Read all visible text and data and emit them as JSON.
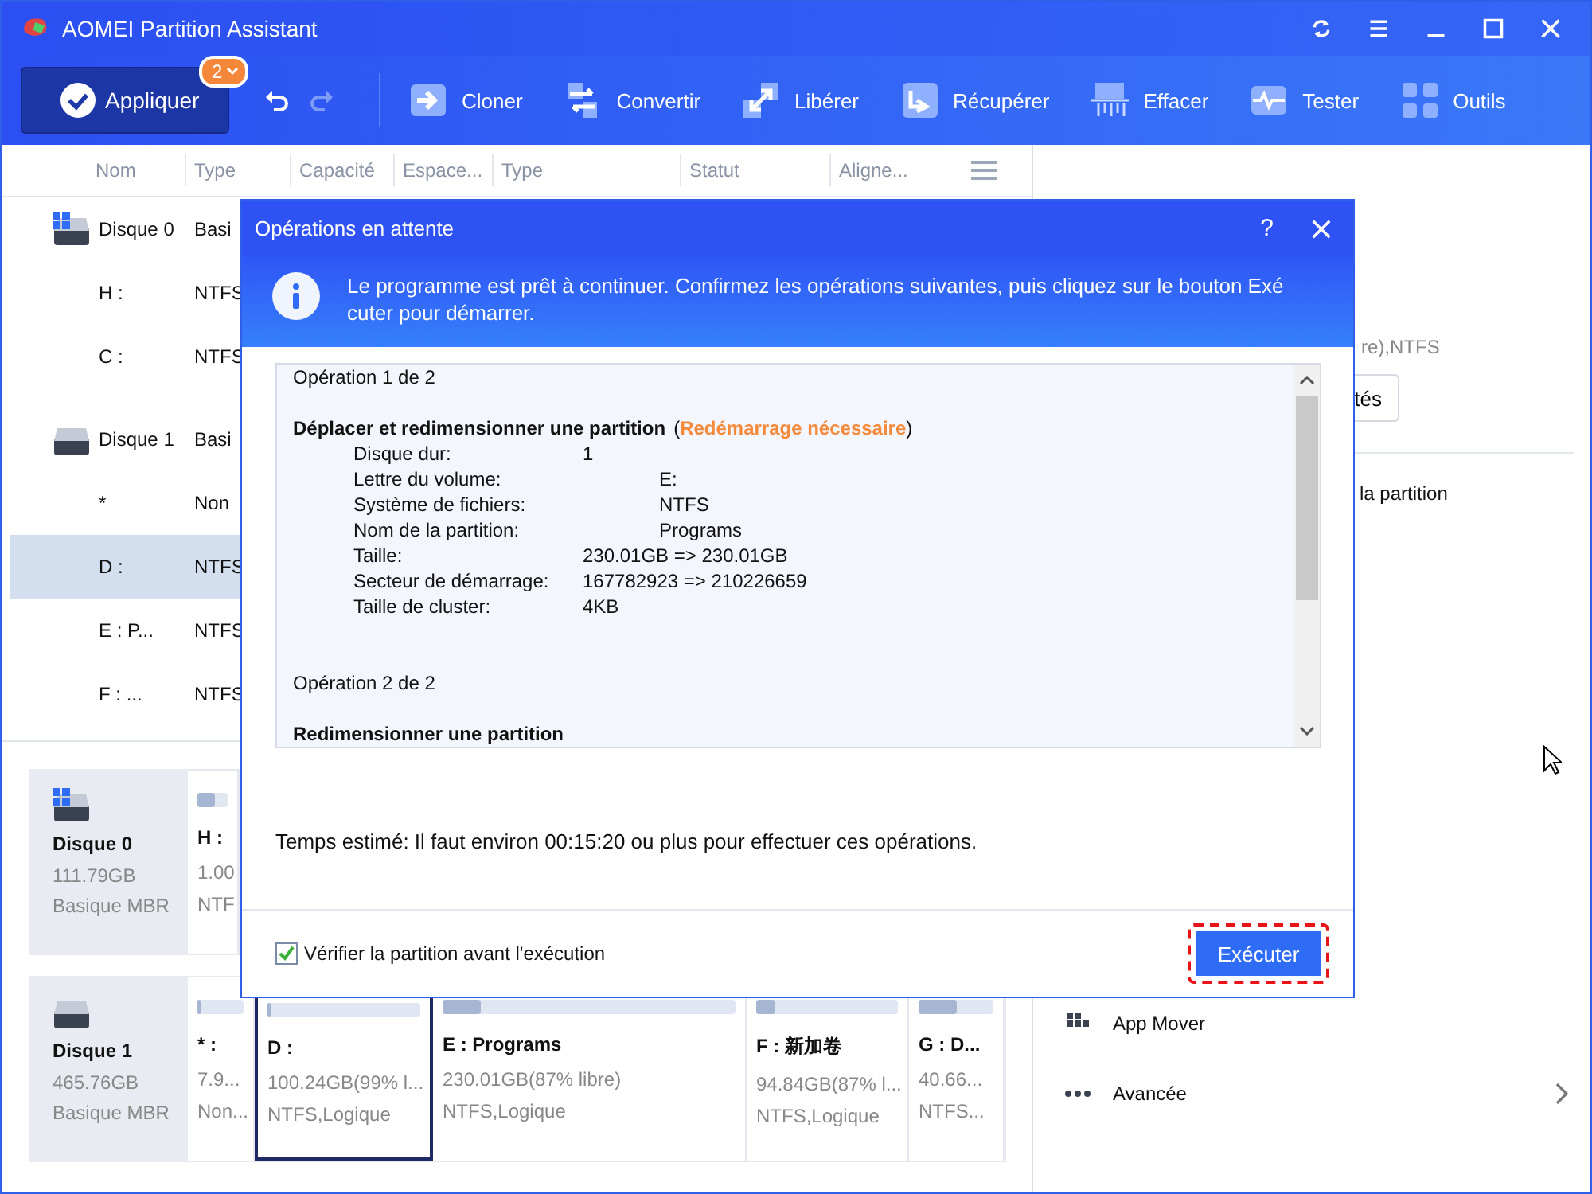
{
  "window": {
    "title": "AOMEI Partition Assistant"
  },
  "toolbar": {
    "apply": {
      "label": "Appliquer",
      "badge": "2"
    },
    "history": [
      {
        "kind": "undo",
        "disabled": false
      },
      {
        "kind": "redo",
        "disabled": true
      }
    ],
    "tools": [
      {
        "kind": "clone",
        "label": "Cloner"
      },
      {
        "kind": "convert",
        "label": "Convertir"
      },
      {
        "kind": "free",
        "label": "Libérer"
      },
      {
        "kind": "recover",
        "label": "Récupérer"
      },
      {
        "kind": "wipe",
        "label": "Effacer"
      },
      {
        "kind": "test",
        "label": "Tester"
      },
      {
        "kind": "tools",
        "label": "Outils"
      }
    ]
  },
  "table": {
    "columns": [
      "Nom",
      "Type",
      "Capacité",
      "Espace...",
      "Type",
      "Statut",
      "Aligne..."
    ],
    "rows": [
      {
        "kind": "disk",
        "system": true,
        "name": "Disque 0",
        "type": "Basi",
        "selected": false
      },
      {
        "kind": "partition",
        "name": "H :",
        "type": "NTFS",
        "selected": false
      },
      {
        "kind": "partition",
        "name": "C :",
        "type": "NTFS",
        "selected": false
      },
      {
        "kind": "disk",
        "system": false,
        "name": "Disque 1",
        "type": "Basi",
        "selected": false
      },
      {
        "kind": "partition",
        "name": "*",
        "type": "Non",
        "selected": false
      },
      {
        "kind": "partition",
        "name": "D :",
        "type": "NTFS",
        "selected": true
      },
      {
        "kind": "partition",
        "name": "E : P...",
        "type": "NTFS",
        "selected": false
      },
      {
        "kind": "partition",
        "name": "F : ...",
        "type": "NTFS",
        "selected": false
      }
    ]
  },
  "disk_map": [
    {
      "name": "Disque 0",
      "system": true,
      "size": "111.79GB",
      "style": "Basique MBR",
      "partitions": [
        {
          "label": "H :",
          "size": "1.00",
          "fs": "NTF",
          "level": 0.6,
          "selected": false
        }
      ]
    },
    {
      "name": "Disque 1",
      "system": false,
      "size": "465.76GB",
      "style": "Basique MBR",
      "partitions": [
        {
          "label": "* :",
          "size": "7.9...",
          "fs": "Non...",
          "level": 0,
          "selected": false
        },
        {
          "label": "D :",
          "size": "100.24GB(99% l...",
          "fs": "NTFS,Logique",
          "level": 0.01,
          "selected": true
        },
        {
          "label": "E : Programs",
          "size": "230.01GB(87% libre)",
          "fs": "NTFS,Logique",
          "level": 0.13,
          "selected": false
        },
        {
          "label": "F : 新加卷",
          "size": "94.84GB(87% l...",
          "fs": "NTFS,Logique",
          "level": 0.13,
          "selected": false
        },
        {
          "label": "G : D...",
          "size": "40.66...",
          "fs": "NTFS...",
          "level": 0.5,
          "selected": false
        }
      ]
    }
  ],
  "right_panel": {
    "info": "re),NTFS",
    "button": "tés",
    "item": "la partition",
    "menu": [
      {
        "kind": "apps",
        "label": "App Mover"
      },
      {
        "kind": "more",
        "label": "Avancée"
      }
    ]
  },
  "dialog": {
    "title": "Opérations en attente",
    "help": "?",
    "message": "Le programme est prêt à continuer. Confirmez les opérations suivantes, puis cliquez sur le bouton Exé cuter pour démarrer.",
    "operations": [
      {
        "heading": "Opération 1 de 2",
        "title": "Déplacer et redimensionner une partition",
        "note_open": "(",
        "note": "Redémarrage nécessaire",
        "note_close": ")",
        "details": [
          {
            "label": "Disque dur:",
            "value": "1",
            "kind": "near"
          },
          {
            "label": "Lettre du volume:",
            "value": "E:",
            "kind": "far"
          },
          {
            "label": "Système de fichiers:",
            "value": "NTFS",
            "kind": "far"
          },
          {
            "label": "Nom de la partition:",
            "value": "Programs",
            "kind": "far"
          },
          {
            "label": "Taille:",
            "value": "230.01GB => 230.01GB",
            "kind": "near"
          },
          {
            "label": "Secteur de démarrage:",
            "value": "167782923 => 210226659",
            "kind": "near"
          },
          {
            "label": "Taille de cluster:",
            "value": "4KB",
            "kind": "near"
          }
        ]
      },
      {
        "heading": "Opération 2 de 2",
        "title": "Redimensionner une partition"
      }
    ],
    "estimate": "Temps estimé: Il faut environ 00:15:20 ou plus pour effectuer ces opérations.",
    "verify": {
      "label": "Vérifier la partition avant l'exécution",
      "checked": true
    },
    "execute": "Exécuter"
  }
}
